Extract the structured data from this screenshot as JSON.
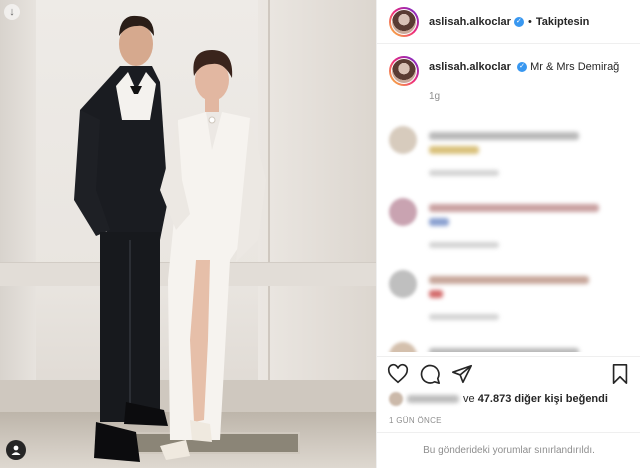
{
  "post": {
    "username": "aslisah.alkoclar",
    "follow_status": "Takiptesin",
    "separator": "•",
    "caption": "Mr & Mrs Demirağ",
    "caption_time": "1g",
    "likes_count": "47.873",
    "likes_prefix": "ve",
    "likes_suffix": "diğer kişi beğendi",
    "time_ago": "1 GÜN ÖNCE",
    "comments_restricted": "Bu gönderideki yorumlar sınırlandırıldı."
  },
  "icons": {
    "verified": "verified-badge",
    "arrow": "arrow-down-icon",
    "tag": "person-tag-icon",
    "like": "heart-icon",
    "comment": "comment-icon",
    "share": "send-icon",
    "save": "bookmark-icon"
  },
  "colors": {
    "verified": "#3897f0",
    "muted": "#8e8e8e",
    "text": "#262626"
  }
}
